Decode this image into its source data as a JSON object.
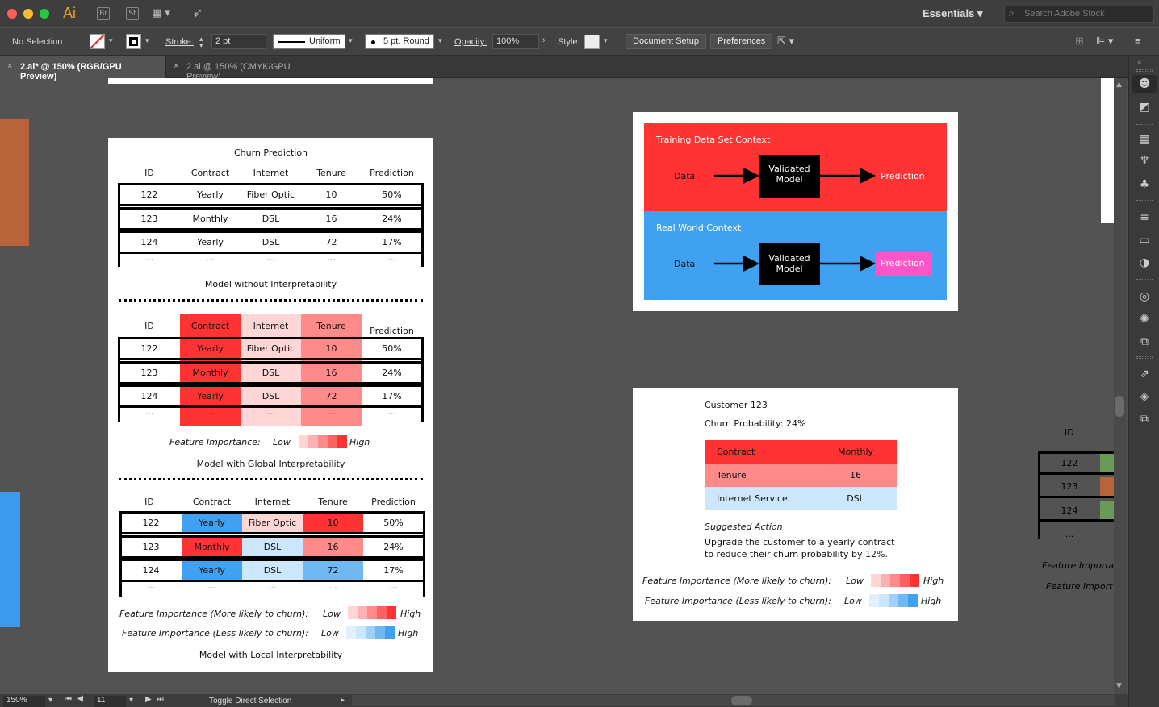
{
  "app": {
    "name": "Ai",
    "bridge": "Br",
    "stock": "St"
  },
  "workspace": {
    "name": "Essentials",
    "search_placeholder": "Search Adobe Stock"
  },
  "control": {
    "selection": "No Selection",
    "stroke_label": "Stroke:",
    "stroke_value": "2 pt",
    "profile": "Uniform",
    "brush": "5 pt. Round",
    "opacity_label": "Opacity:",
    "opacity_value": "100%",
    "style_label": "Style:",
    "doc_setup": "Document Setup",
    "preferences": "Preferences"
  },
  "tabs": [
    {
      "label": "2.ai* @ 150% (RGB/GPU Preview)",
      "active": true
    },
    {
      "label": "2.ai @ 150% (CMYK/GPU Preview)",
      "active": false
    }
  ],
  "status": {
    "zoom": "150%",
    "page": "11",
    "tool": "Toggle Direct Selection"
  },
  "colors": {
    "red": "#ff3333",
    "med_red": "#ff8a8a",
    "light_red": "#ffd6d6",
    "blue": "#3fa1f0",
    "med_blue": "#6fb8f2",
    "light_blue": "#cce6fb",
    "pink": "#ff55c8",
    "orange": "#b8633a",
    "left_blue": "#3c99ee"
  },
  "artboard1": {
    "title": "Churn Prediction",
    "headers": [
      "ID",
      "Contract",
      "Internet",
      "Tenure",
      "Prediction"
    ],
    "rows": [
      [
        "122",
        "Yearly",
        "Fiber Optic",
        "10",
        "50%"
      ],
      [
        "123",
        "Monthly",
        "DSL",
        "16",
        "24%"
      ],
      [
        "124",
        "Yearly",
        "DSL",
        "72",
        "17%"
      ]
    ],
    "ellipsis": "...",
    "caption1": "Model without Interpretability",
    "caption2": "Model with Global Interpretability",
    "caption3": "Model with Local Interpretability",
    "fi_label": "Feature Importance:",
    "fi_more": "Feature Importance (More likely to churn):",
    "fi_less": "Feature Importance (Less likely to churn):",
    "low": "Low",
    "high": "High"
  },
  "artboard2": {
    "training_title": "Training Data Set Context",
    "real_title": "Real World Context",
    "data": "Data",
    "model": "Validated Model",
    "prediction": "Prediction"
  },
  "artboard3": {
    "customer": "Customer 123",
    "probability": "Churn Probability: 24%",
    "features": [
      [
        "Contract",
        "Monthly"
      ],
      [
        "Tenure",
        "16"
      ],
      [
        "Internet Service",
        "DSL"
      ]
    ],
    "suggested_title": "Suggested Action",
    "suggested_line1": "Upgrade the customer to a yearly contract",
    "suggested_line2": "to reduce their churn probability by 12%.",
    "fi_more": "Feature Importance (More likely to churn):",
    "fi_less": "Feature Importance (Less likely to churn):",
    "low": "Low",
    "high": "High"
  },
  "artboard4": {
    "id": "ID",
    "rows": [
      "122",
      "123",
      "124"
    ],
    "ellipsis": "...",
    "fi1": "Feature Importa",
    "fi2": "Feature Import"
  }
}
